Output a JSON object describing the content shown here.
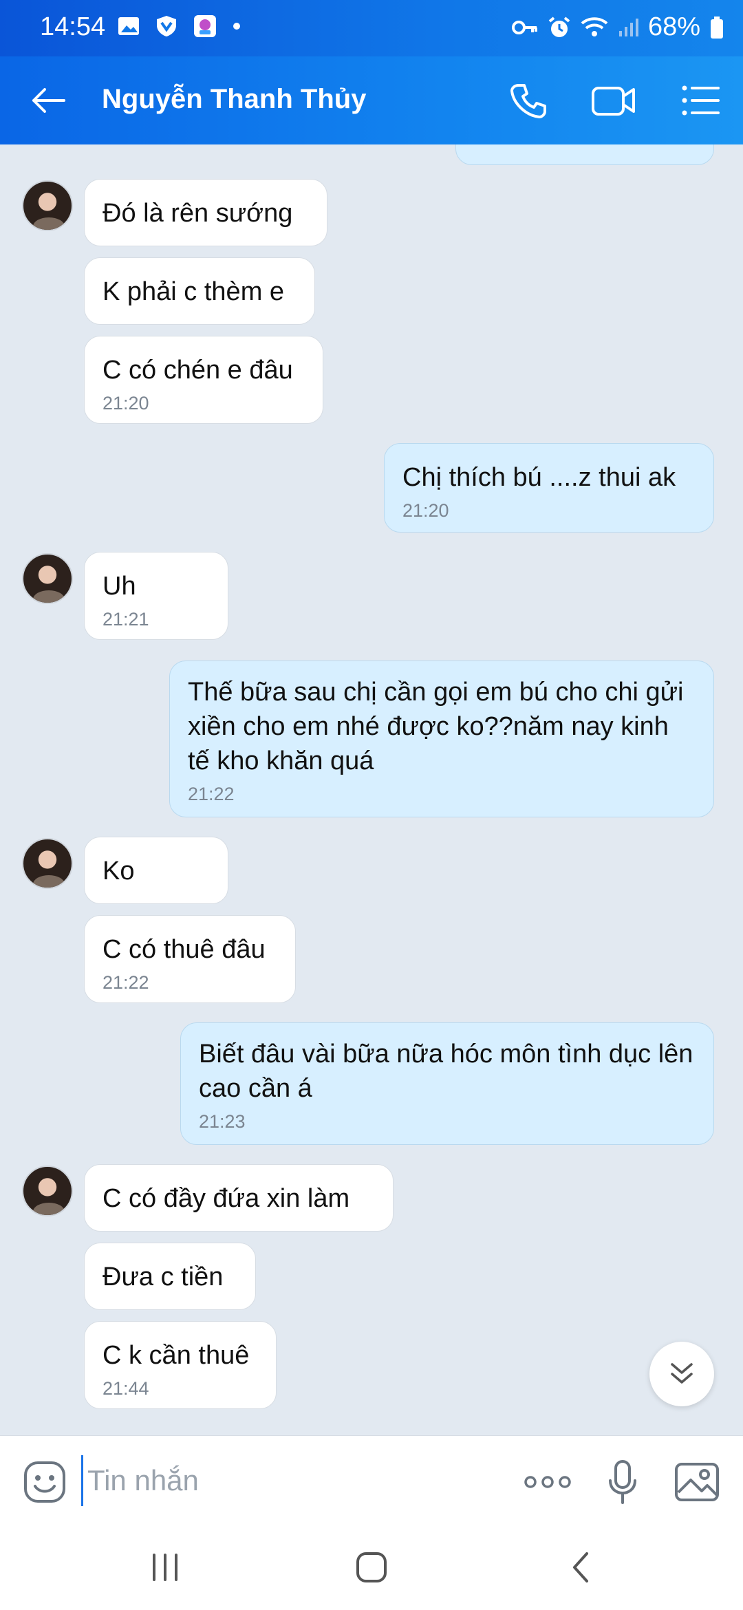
{
  "status_bar": {
    "time": "14:54",
    "battery": "68%"
  },
  "header": {
    "contact_name": "Nguyễn Thanh Thủy"
  },
  "messages": [
    {
      "direction": "in",
      "text": "Đó là rên sướng",
      "time": ""
    },
    {
      "direction": "in",
      "text": "K phải c thèm e",
      "time": ""
    },
    {
      "direction": "in",
      "text": "C có chén e đâu",
      "time": "21:20"
    },
    {
      "direction": "out",
      "text": "Chị thích bú ....z thui ak",
      "time": "21:20"
    },
    {
      "direction": "in",
      "text": "Uh",
      "time": "21:21"
    },
    {
      "direction": "out",
      "text": "Thế bữa sau chị cần gọi em bú cho chi gửi xiền cho em nhé được ko??năm nay kinh tế kho khăn quá",
      "time": "21:22"
    },
    {
      "direction": "in",
      "text": "Ko",
      "time": ""
    },
    {
      "direction": "in",
      "text": "C có thuê đâu",
      "time": "21:22"
    },
    {
      "direction": "out",
      "text": "Biết đâu vài bữa nữa hóc môn tình dục lên cao cần á",
      "time": "21:23"
    },
    {
      "direction": "in",
      "text": "C có đầy đứa xin làm",
      "time": ""
    },
    {
      "direction": "in",
      "text": "Đưa c tiền",
      "time": ""
    },
    {
      "direction": "in",
      "text": "C k cần thuê",
      "time": "21:44"
    }
  ],
  "input": {
    "placeholder": "Tin nhắn"
  },
  "icons": {
    "back": "arrow-left-icon",
    "call": "phone-icon",
    "video": "video-camera-icon",
    "menu": "list-icon",
    "emoji": "emoji-icon",
    "more": "more-dots-icon",
    "mic": "microphone-icon",
    "image": "image-icon",
    "scroll": "chevron-double-down-icon"
  },
  "colors": {
    "header": "#1284ef",
    "outgoing_bubble": "#d7efff",
    "incoming_bubble": "#ffffff",
    "background": "#e2e9f1"
  }
}
